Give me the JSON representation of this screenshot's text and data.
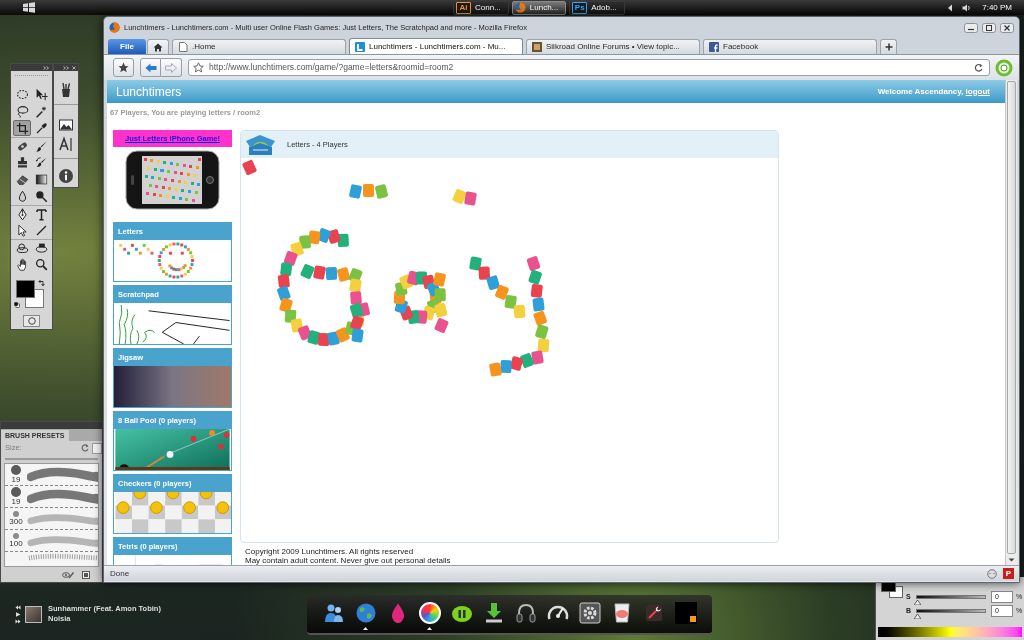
{
  "taskbar": {
    "buttons": [
      {
        "kind": "tile",
        "tile_text": "Ai",
        "color": "#f7931e",
        "label": "Conn...",
        "selected": false
      },
      {
        "kind": "browser",
        "label": "Lunch...",
        "selected": true
      },
      {
        "kind": "tile",
        "tile_text": "Ps",
        "color": "#31a8ff",
        "label": "Adob...",
        "selected": false
      }
    ],
    "clock": "7:40 PM"
  },
  "tools_panel": {
    "tools": [
      {
        "kind": "marquee",
        "selected": false
      },
      {
        "kind": "move",
        "selected": false
      },
      {
        "kind": "lasso",
        "selected": false
      },
      {
        "kind": "wand",
        "selected": false
      },
      {
        "kind": "crop",
        "selected": true
      },
      {
        "kind": "eyedropper",
        "selected": false
      },
      {
        "kind": "healing",
        "selected": false
      },
      {
        "kind": "brush",
        "selected": false
      },
      {
        "kind": "stamp",
        "selected": false
      },
      {
        "kind": "history",
        "selected": false
      },
      {
        "kind": "eraser",
        "selected": false
      },
      {
        "kind": "gradient",
        "selected": false
      },
      {
        "kind": "blur",
        "selected": false
      },
      {
        "kind": "dodge",
        "selected": false
      },
      {
        "kind": "pen",
        "selected": false
      },
      {
        "kind": "type",
        "selected": false
      },
      {
        "kind": "pathselect",
        "selected": false
      },
      {
        "kind": "line",
        "selected": false
      },
      {
        "kind": "rotate3d",
        "selected": false
      },
      {
        "kind": "camera3d",
        "selected": false
      },
      {
        "kind": "hand",
        "selected": false
      },
      {
        "kind": "zoom",
        "selected": false
      }
    ]
  },
  "panel_dock": {
    "items": [
      {
        "kind": "brushes"
      },
      {
        "kind": "histogram"
      },
      {
        "kind": "character"
      },
      {
        "kind": "info"
      }
    ]
  },
  "brush_presets": {
    "title": "BRUSH PRESETS",
    "size_label": "Size:",
    "brushes": [
      {
        "kind": "hard",
        "size": "19"
      },
      {
        "kind": "hard",
        "size": "19"
      },
      {
        "kind": "soft",
        "size": "300"
      },
      {
        "kind": "soft",
        "size": "100"
      },
      {
        "kind": "texture"
      }
    ]
  },
  "browser": {
    "title": "Lunchtimers - Lunchtimers.com - Multi user Online Flash Games: Just Letters, The Scratchpad and more - Mozilla Firefox",
    "file_button": "File",
    "tabs": [
      {
        "kind": "page",
        "label": ".Home",
        "selected": false
      },
      {
        "kind": "site",
        "label": "Lunchtimers - Lunchtimers.com - Mu...",
        "selected": true
      },
      {
        "kind": "forum",
        "label": "Silkroad Online Forums • View topic...",
        "selected": false
      },
      {
        "kind": "social",
        "label": "Facebook",
        "selected": false
      }
    ],
    "url": "http://www.lunchtimers.com/game/?game=letters&roomid=room2",
    "status": "Done",
    "addon_badge": "P"
  },
  "site": {
    "name": "Lunchtimers",
    "welcome": "Welcome Ascendancy,",
    "logout": "logout",
    "info": "67 Players, You are playing letters / room2",
    "promo": "Just Letters iPhone Game!",
    "games": [
      {
        "kind": "letters",
        "title": "Letters"
      },
      {
        "kind": "scratchpad",
        "title": "Scratchpad"
      },
      {
        "kind": "jigsaw",
        "title": "Jigsaw"
      },
      {
        "kind": "pool",
        "title": "8 Ball Pool (0 players)"
      },
      {
        "kind": "checkers",
        "title": "Checkers (0 players)"
      },
      {
        "kind": "tetris",
        "title": "Tetris (0 players)"
      }
    ],
    "game_panel": {
      "title": "Letters - 4 Players"
    },
    "footer": [
      "Copyright 2009 Lunchtimers. All rights reserved",
      "May contain adult content. Never give out personal details"
    ]
  },
  "music": {
    "track": "Sunhammer (Feat. Amon Tobin)",
    "artist": "Noisia"
  },
  "dock": {
    "items": [
      {
        "kind": "people",
        "running": false
      },
      {
        "kind": "globe",
        "running": true
      },
      {
        "kind": "drop",
        "running": false
      },
      {
        "kind": "color-wheel",
        "running": true
      },
      {
        "kind": "pause",
        "running": false
      },
      {
        "kind": "download",
        "running": false
      },
      {
        "kind": "headphones",
        "running": false
      },
      {
        "kind": "gauge",
        "running": false
      },
      {
        "kind": "gear",
        "running": false
      },
      {
        "kind": "cup",
        "running": false
      },
      {
        "kind": "tools",
        "running": false
      },
      {
        "kind": "window",
        "running": false
      }
    ]
  },
  "color_panel": {
    "sliders": [
      {
        "label": "S",
        "value": "0",
        "unit": "%",
        "level": 0
      },
      {
        "label": "B",
        "value": "0",
        "unit": "%",
        "level": 0
      }
    ]
  }
}
